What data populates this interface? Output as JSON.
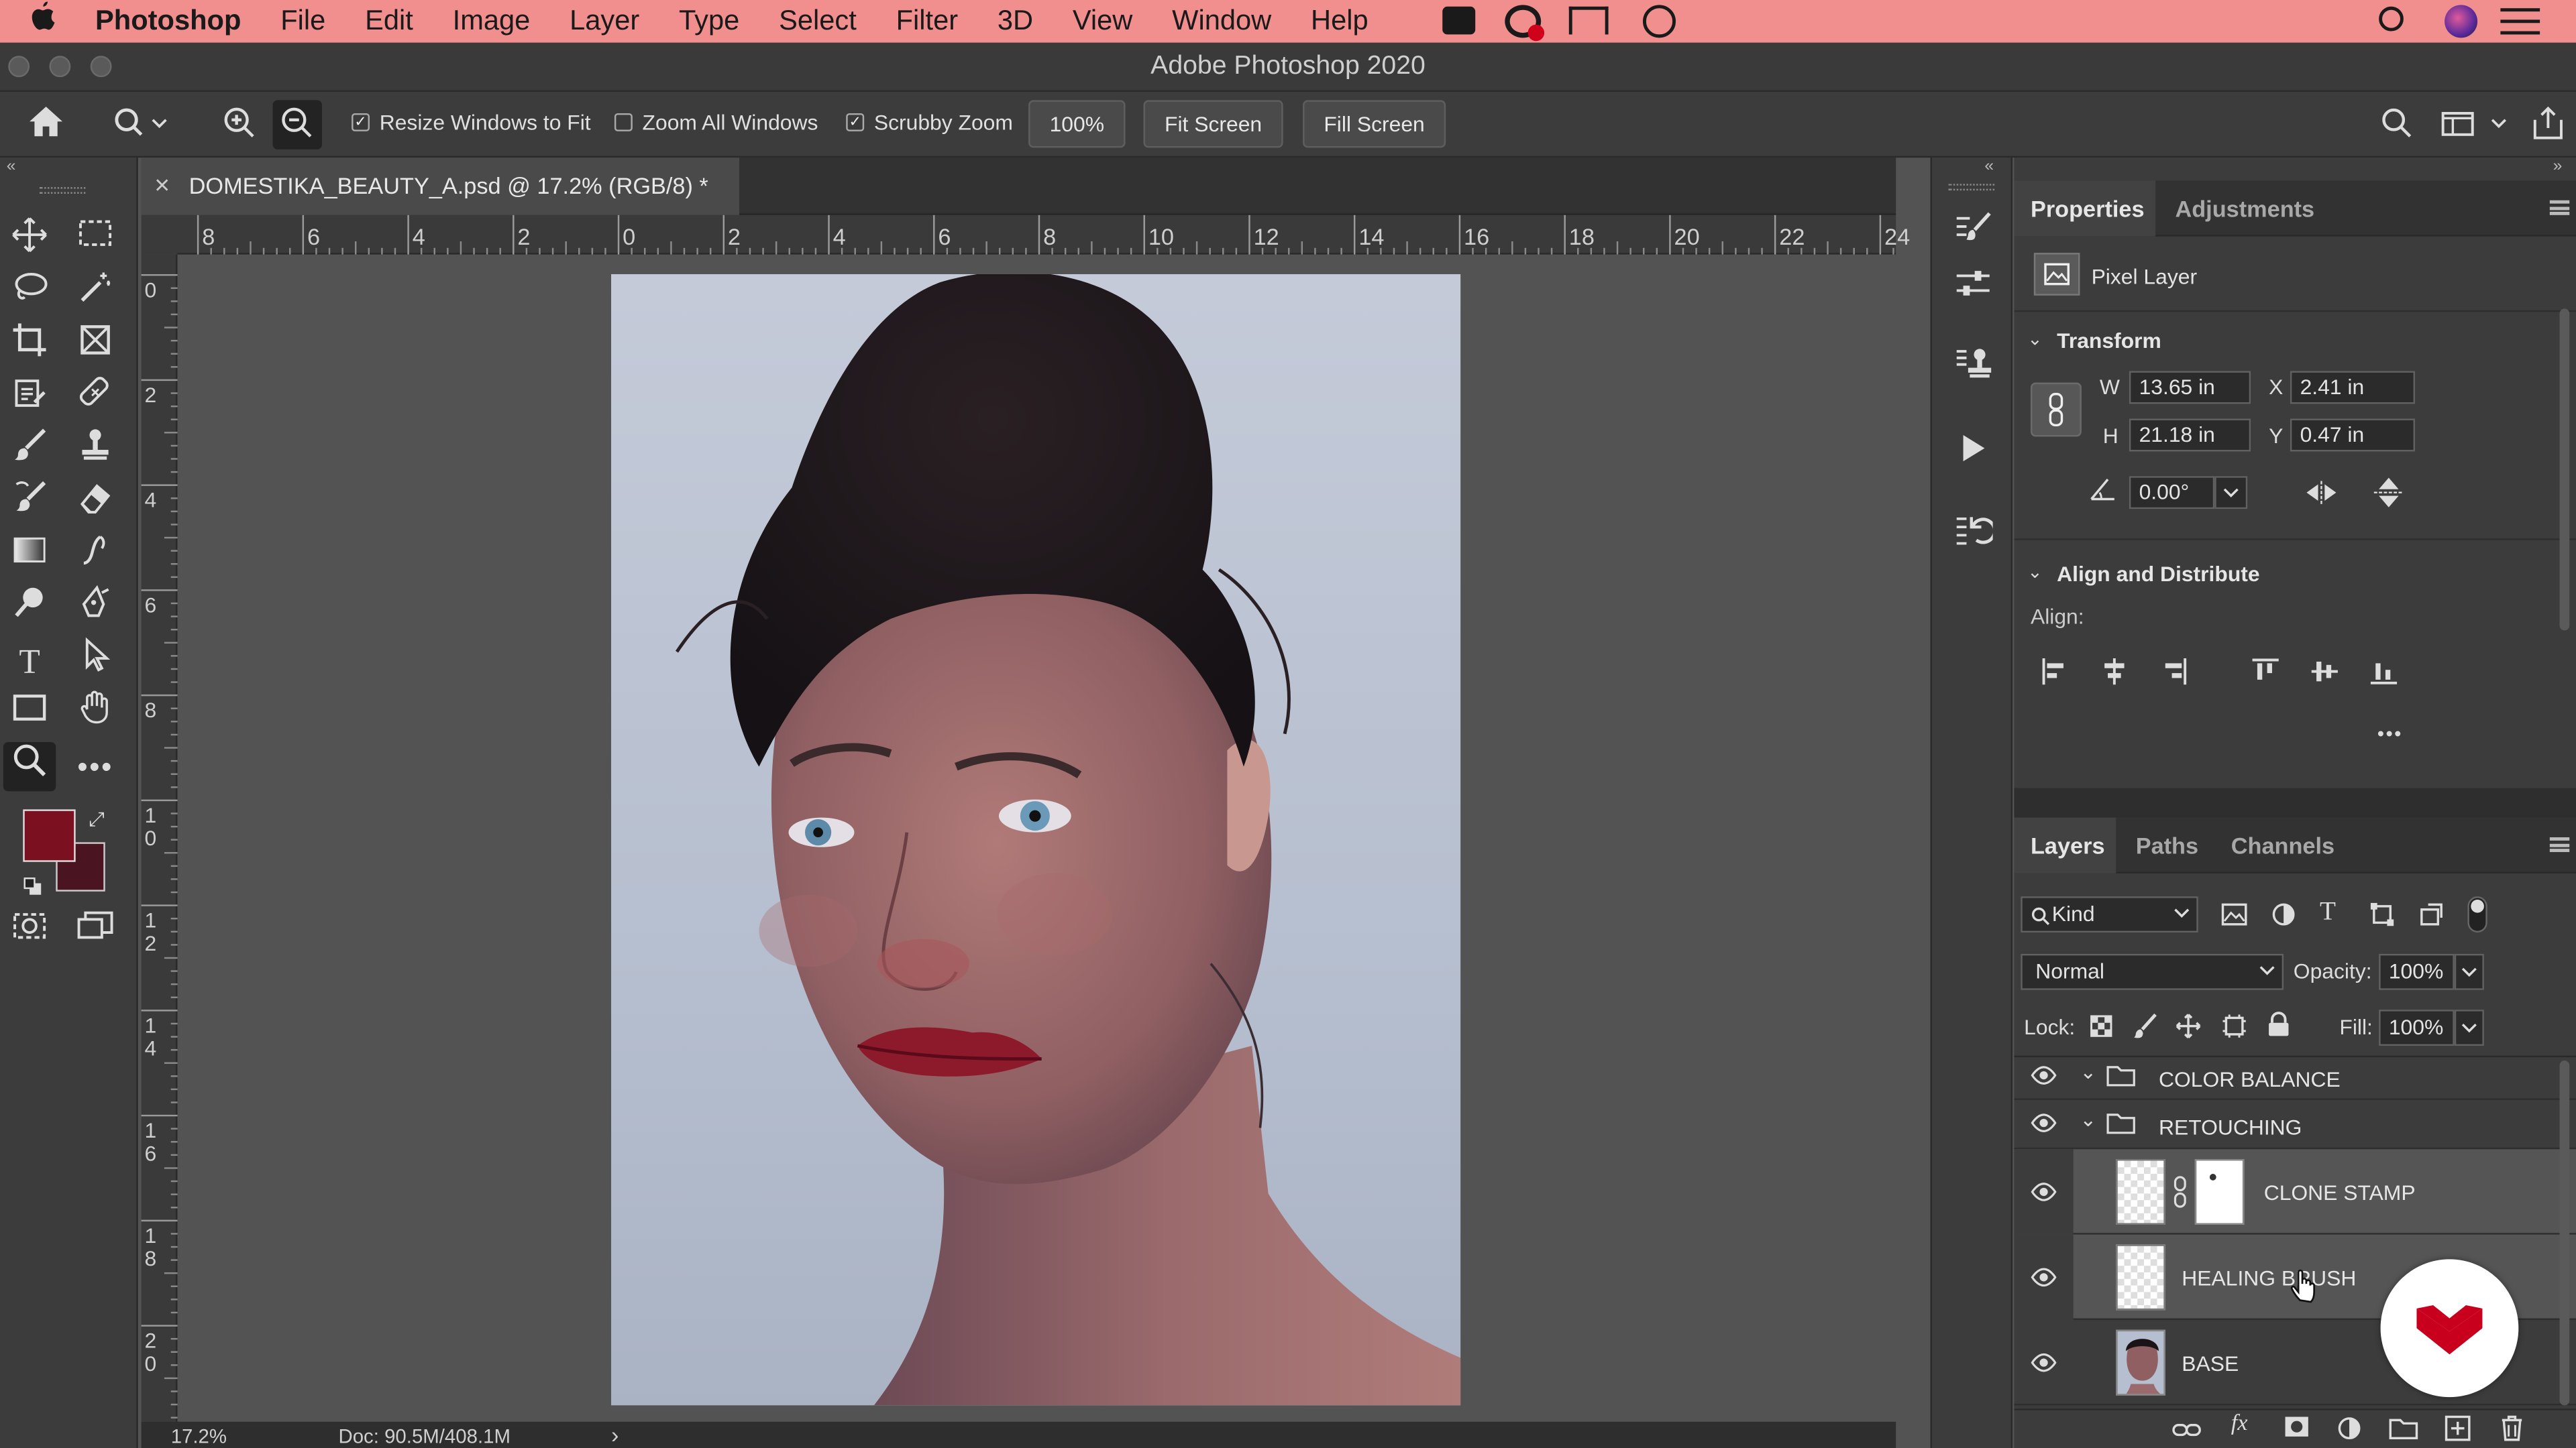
{
  "menubar": {
    "apple": "",
    "app_name": "Photoshop",
    "items": [
      "File",
      "Edit",
      "Image",
      "Layer",
      "Type",
      "Select",
      "Filter",
      "3D",
      "View",
      "Window",
      "Help"
    ]
  },
  "window": {
    "title": "Adobe Photoshop 2020"
  },
  "options": {
    "resize_windows": "Resize Windows to Fit",
    "zoom_all": "Zoom All Windows",
    "scrubby": "Scrubby Zoom",
    "zoom_value": "100%",
    "fit_screen": "Fit Screen",
    "fill_screen": "Fill Screen"
  },
  "document": {
    "tab_title": "DOMESTIKA_BEAUTY_A.psd @ 17.2% (RGB/8) *",
    "close": "×"
  },
  "ruler": {
    "top": [
      "8",
      "6",
      "4",
      "2",
      "0",
      "2",
      "4",
      "6",
      "8",
      "10",
      "12",
      "14",
      "16",
      "18",
      "20",
      "22",
      "24"
    ],
    "left": [
      "0",
      "2",
      "4",
      "6",
      "8",
      "1\n0",
      "1\n2",
      "1\n4",
      "1\n6",
      "1\n8",
      "2\n0"
    ]
  },
  "status": {
    "zoom": "17.2%",
    "doc": "Doc: 90.5M/408.1M",
    "arrow": "›"
  },
  "colors": {
    "foreground": "#7a1020",
    "background": "#4a1520",
    "accent": "#c8001e"
  },
  "properties": {
    "tab_properties": "Properties",
    "tab_adjustments": "Adjustments",
    "layer_type": "Pixel Layer",
    "transform_title": "Transform",
    "w_label": "W",
    "w_value": "13.65 in",
    "h_label": "H",
    "h_value": "21.18 in",
    "x_label": "X",
    "x_value": "2.41 in",
    "y_label": "Y",
    "y_value": "0.47 in",
    "angle_value": "0.00°",
    "align_title": "Align and Distribute",
    "align_label": "Align:",
    "more": "•••"
  },
  "layers_panel": {
    "tab_layers": "Layers",
    "tab_paths": "Paths",
    "tab_channels": "Channels",
    "filter_kind": "Kind",
    "blend_mode": "Normal",
    "opacity_label": "Opacity:",
    "opacity_value": "100%",
    "lock_label": "Lock:",
    "fill_label": "Fill:",
    "fill_value": "100%",
    "layers": [
      {
        "name": "COLOR BALANCE",
        "type": "group"
      },
      {
        "name": "RETOUCHING",
        "type": "group"
      },
      {
        "name": "CLONE STAMP",
        "type": "masked"
      },
      {
        "name": "HEALING BRUSH",
        "type": "pixel"
      },
      {
        "name": "BASE",
        "type": "photo"
      }
    ]
  }
}
